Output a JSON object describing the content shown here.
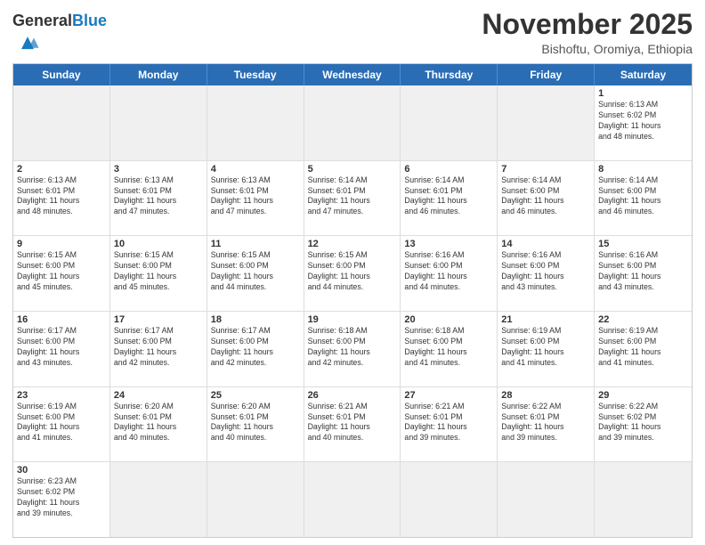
{
  "logo": {
    "text_general": "General",
    "text_blue": "Blue"
  },
  "title": "November 2025",
  "subtitle": "Bishoftu, Oromiya, Ethiopia",
  "day_headers": [
    "Sunday",
    "Monday",
    "Tuesday",
    "Wednesday",
    "Thursday",
    "Friday",
    "Saturday"
  ],
  "cells": [
    {
      "day": "",
      "info": "",
      "empty": true
    },
    {
      "day": "",
      "info": "",
      "empty": true
    },
    {
      "day": "",
      "info": "",
      "empty": true
    },
    {
      "day": "",
      "info": "",
      "empty": true
    },
    {
      "day": "",
      "info": "",
      "empty": true
    },
    {
      "day": "",
      "info": "",
      "empty": true
    },
    {
      "day": "1",
      "info": "Sunrise: 6:13 AM\nSunset: 6:02 PM\nDaylight: 11 hours\nand 48 minutes.",
      "empty": false
    },
    {
      "day": "2",
      "info": "Sunrise: 6:13 AM\nSunset: 6:01 PM\nDaylight: 11 hours\nand 48 minutes.",
      "empty": false
    },
    {
      "day": "3",
      "info": "Sunrise: 6:13 AM\nSunset: 6:01 PM\nDaylight: 11 hours\nand 47 minutes.",
      "empty": false
    },
    {
      "day": "4",
      "info": "Sunrise: 6:13 AM\nSunset: 6:01 PM\nDaylight: 11 hours\nand 47 minutes.",
      "empty": false
    },
    {
      "day": "5",
      "info": "Sunrise: 6:14 AM\nSunset: 6:01 PM\nDaylight: 11 hours\nand 47 minutes.",
      "empty": false
    },
    {
      "day": "6",
      "info": "Sunrise: 6:14 AM\nSunset: 6:01 PM\nDaylight: 11 hours\nand 46 minutes.",
      "empty": false
    },
    {
      "day": "7",
      "info": "Sunrise: 6:14 AM\nSunset: 6:00 PM\nDaylight: 11 hours\nand 46 minutes.",
      "empty": false
    },
    {
      "day": "8",
      "info": "Sunrise: 6:14 AM\nSunset: 6:00 PM\nDaylight: 11 hours\nand 46 minutes.",
      "empty": false
    },
    {
      "day": "9",
      "info": "Sunrise: 6:15 AM\nSunset: 6:00 PM\nDaylight: 11 hours\nand 45 minutes.",
      "empty": false
    },
    {
      "day": "10",
      "info": "Sunrise: 6:15 AM\nSunset: 6:00 PM\nDaylight: 11 hours\nand 45 minutes.",
      "empty": false
    },
    {
      "day": "11",
      "info": "Sunrise: 6:15 AM\nSunset: 6:00 PM\nDaylight: 11 hours\nand 44 minutes.",
      "empty": false
    },
    {
      "day": "12",
      "info": "Sunrise: 6:15 AM\nSunset: 6:00 PM\nDaylight: 11 hours\nand 44 minutes.",
      "empty": false
    },
    {
      "day": "13",
      "info": "Sunrise: 6:16 AM\nSunset: 6:00 PM\nDaylight: 11 hours\nand 44 minutes.",
      "empty": false
    },
    {
      "day": "14",
      "info": "Sunrise: 6:16 AM\nSunset: 6:00 PM\nDaylight: 11 hours\nand 43 minutes.",
      "empty": false
    },
    {
      "day": "15",
      "info": "Sunrise: 6:16 AM\nSunset: 6:00 PM\nDaylight: 11 hours\nand 43 minutes.",
      "empty": false
    },
    {
      "day": "16",
      "info": "Sunrise: 6:17 AM\nSunset: 6:00 PM\nDaylight: 11 hours\nand 43 minutes.",
      "empty": false
    },
    {
      "day": "17",
      "info": "Sunrise: 6:17 AM\nSunset: 6:00 PM\nDaylight: 11 hours\nand 42 minutes.",
      "empty": false
    },
    {
      "day": "18",
      "info": "Sunrise: 6:17 AM\nSunset: 6:00 PM\nDaylight: 11 hours\nand 42 minutes.",
      "empty": false
    },
    {
      "day": "19",
      "info": "Sunrise: 6:18 AM\nSunset: 6:00 PM\nDaylight: 11 hours\nand 42 minutes.",
      "empty": false
    },
    {
      "day": "20",
      "info": "Sunrise: 6:18 AM\nSunset: 6:00 PM\nDaylight: 11 hours\nand 41 minutes.",
      "empty": false
    },
    {
      "day": "21",
      "info": "Sunrise: 6:19 AM\nSunset: 6:00 PM\nDaylight: 11 hours\nand 41 minutes.",
      "empty": false
    },
    {
      "day": "22",
      "info": "Sunrise: 6:19 AM\nSunset: 6:00 PM\nDaylight: 11 hours\nand 41 minutes.",
      "empty": false
    },
    {
      "day": "23",
      "info": "Sunrise: 6:19 AM\nSunset: 6:00 PM\nDaylight: 11 hours\nand 41 minutes.",
      "empty": false
    },
    {
      "day": "24",
      "info": "Sunrise: 6:20 AM\nSunset: 6:01 PM\nDaylight: 11 hours\nand 40 minutes.",
      "empty": false
    },
    {
      "day": "25",
      "info": "Sunrise: 6:20 AM\nSunset: 6:01 PM\nDaylight: 11 hours\nand 40 minutes.",
      "empty": false
    },
    {
      "day": "26",
      "info": "Sunrise: 6:21 AM\nSunset: 6:01 PM\nDaylight: 11 hours\nand 40 minutes.",
      "empty": false
    },
    {
      "day": "27",
      "info": "Sunrise: 6:21 AM\nSunset: 6:01 PM\nDaylight: 11 hours\nand 39 minutes.",
      "empty": false
    },
    {
      "day": "28",
      "info": "Sunrise: 6:22 AM\nSunset: 6:01 PM\nDaylight: 11 hours\nand 39 minutes.",
      "empty": false
    },
    {
      "day": "29",
      "info": "Sunrise: 6:22 AM\nSunset: 6:02 PM\nDaylight: 11 hours\nand 39 minutes.",
      "empty": false
    },
    {
      "day": "30",
      "info": "Sunrise: 6:23 AM\nSunset: 6:02 PM\nDaylight: 11 hours\nand 39 minutes.",
      "empty": false
    },
    {
      "day": "",
      "info": "",
      "empty": true
    },
    {
      "day": "",
      "info": "",
      "empty": true
    },
    {
      "day": "",
      "info": "",
      "empty": true
    },
    {
      "day": "",
      "info": "",
      "empty": true
    },
    {
      "day": "",
      "info": "",
      "empty": true
    },
    {
      "day": "",
      "info": "",
      "empty": true
    }
  ]
}
